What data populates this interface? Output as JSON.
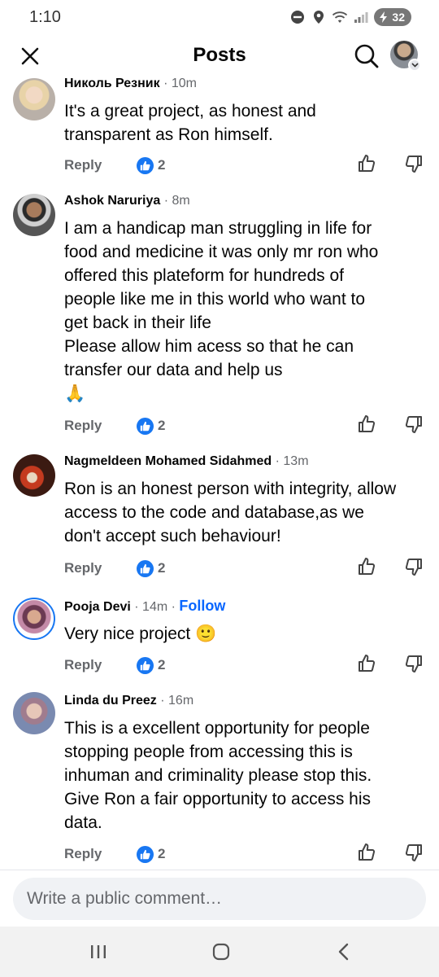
{
  "status_bar": {
    "time": "1:10",
    "icons": [
      "do-not-disturb-icon",
      "location-icon",
      "wifi-icon",
      "signal-icon"
    ],
    "battery": "32"
  },
  "header": {
    "title": "Posts",
    "close_icon": "close-icon",
    "search_icon": "search-icon"
  },
  "comments": [
    {
      "author": "Николь Резник",
      "time": "10m",
      "text": "It's a great project, as honest and\ntransparent as Ron himself.",
      "reply_label": "Reply",
      "likes": "2"
    },
    {
      "author": "Ashok Naruriya",
      "time": "8m",
      "text": "I am a handicap man struggling in life for\nfood and medicine it was only mr ron who\noffered this plateform for hundreds  of\npeople like  me in this world who want to\nget back in their life\nPlease allow him acess so that he can\ntransfer our data and help us\n🙏",
      "reply_label": "Reply",
      "likes": "2"
    },
    {
      "author": "Nagmeldeen Mohamed Sidahmed",
      "time": "13m",
      "text": "Ron is an honest person with integrity, allow\naccess to the code and database,as we\ndon't accept such behaviour!",
      "reply_label": "Reply",
      "likes": "2"
    },
    {
      "author": "Pooja Devi",
      "time": "14m",
      "follow_label": "Follow",
      "text": "Very nice project 🙂",
      "reply_label": "Reply",
      "likes": "2"
    },
    {
      "author": "Linda du Preez",
      "time": "16m",
      "text": "This is a excellent opportunity for people\nstopping people from accessing this is\ninhuman and criminality please stop this.\nGive Ron a fair opportunity to access his\ndata.",
      "reply_label": "Reply",
      "likes": "2"
    }
  ],
  "composer": {
    "placeholder": "Write a public comment…"
  },
  "colors": {
    "accent": "#1877f2",
    "follow": "#0866ff",
    "secondary_text": "#65676b",
    "input_bg": "#f0f2f5",
    "nav_bg": "#f2f2f2"
  }
}
